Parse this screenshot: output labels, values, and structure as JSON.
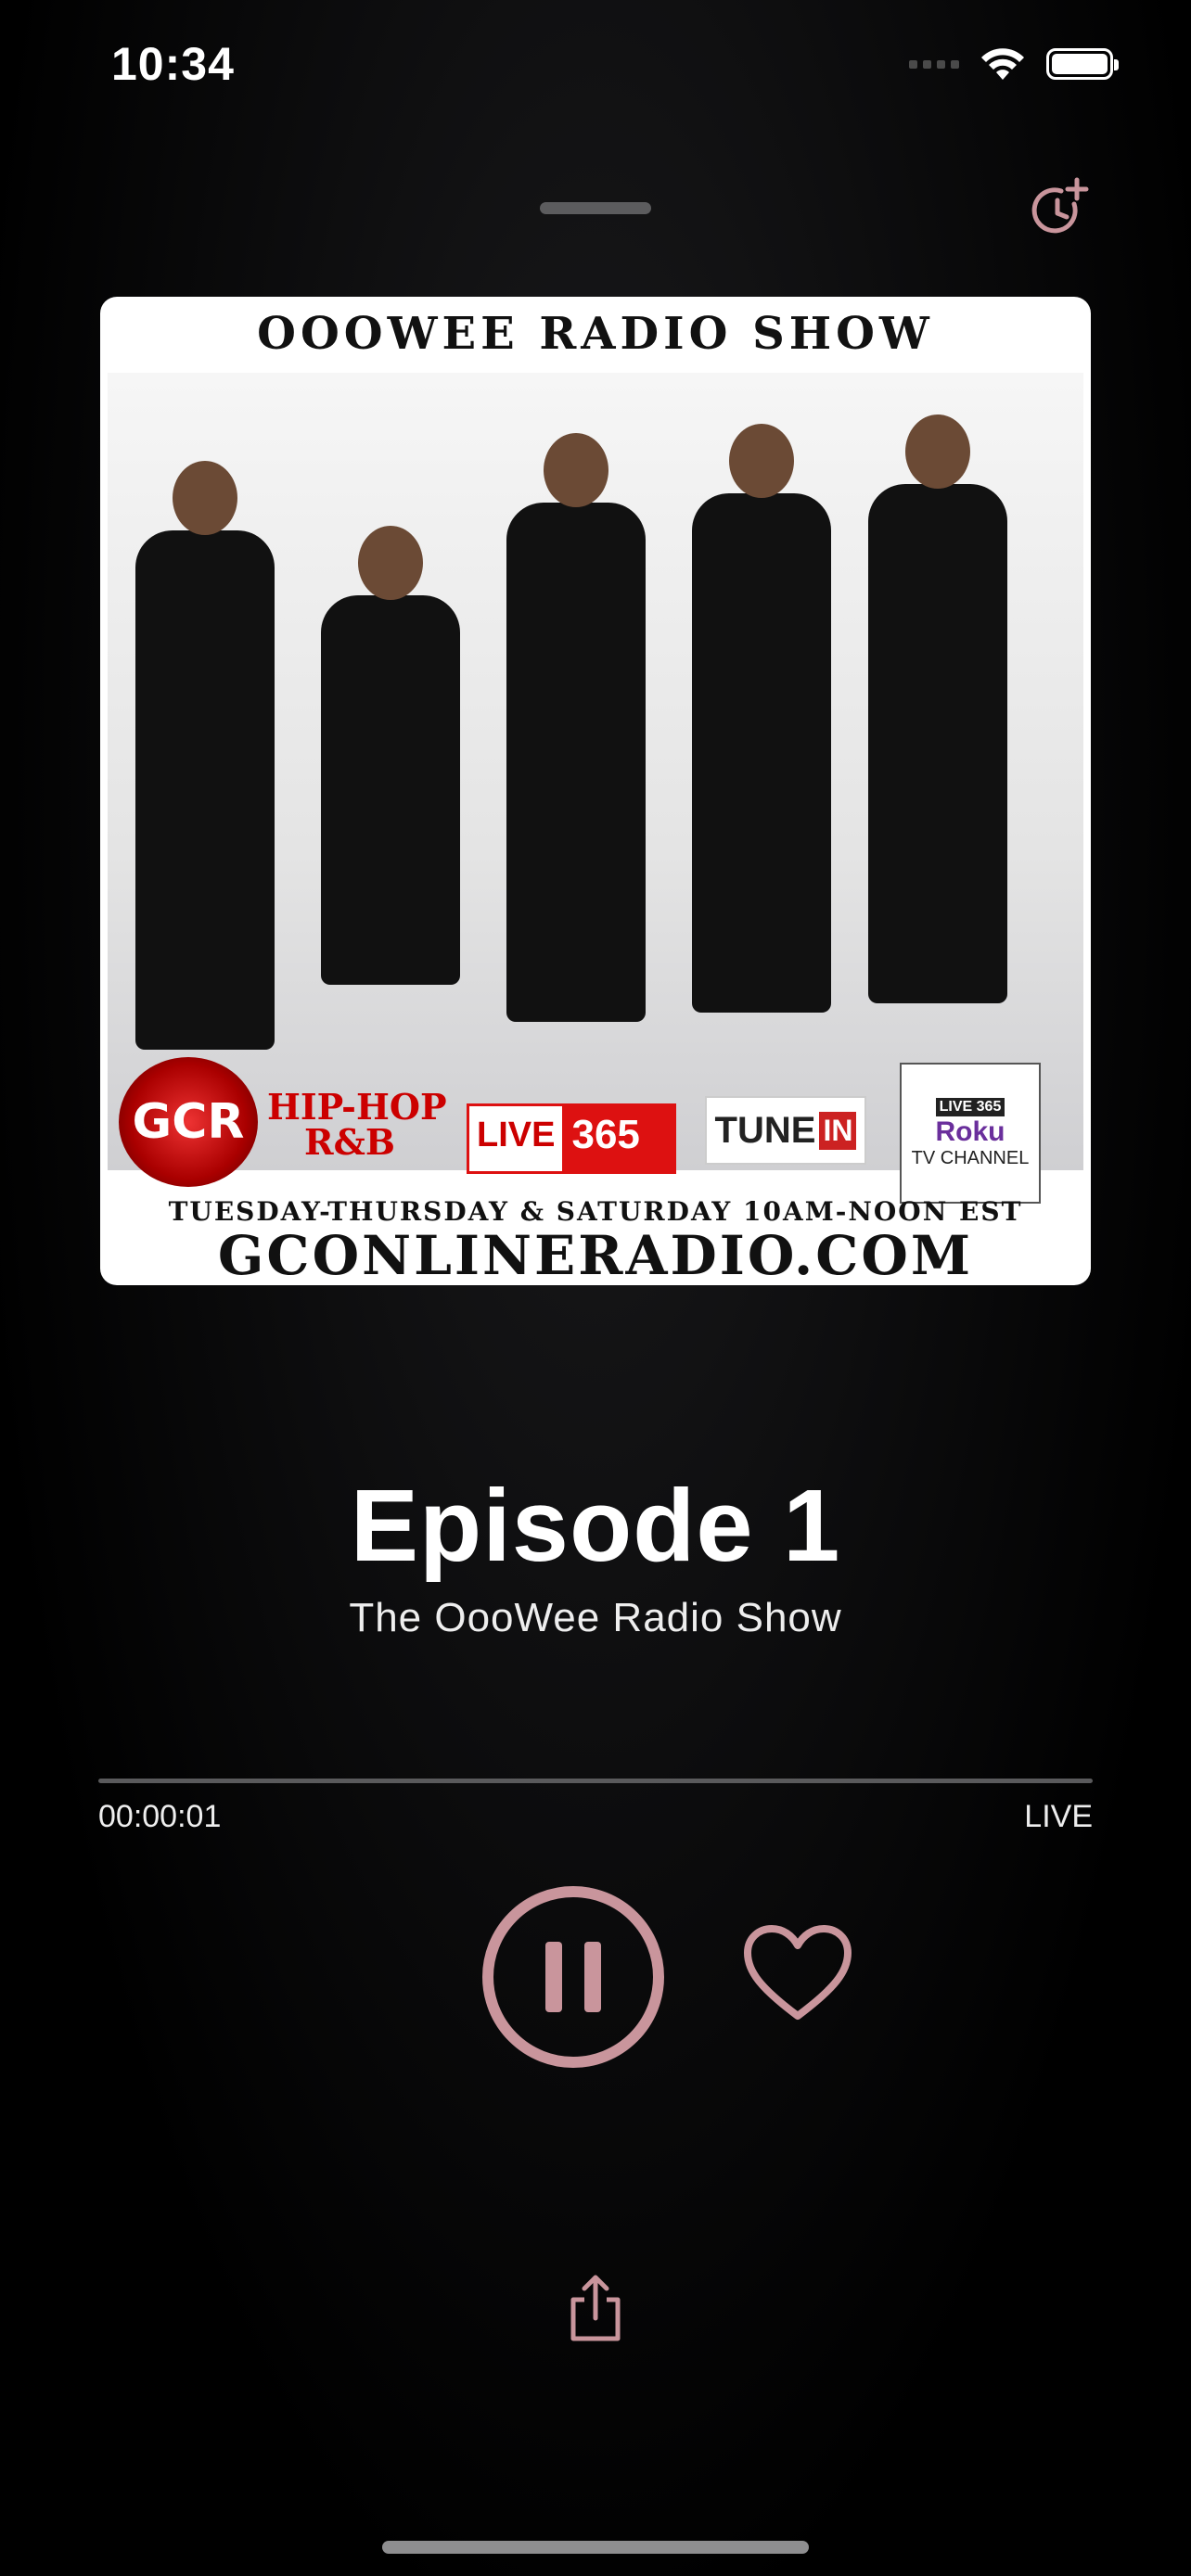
{
  "status_bar": {
    "time": "10:34"
  },
  "artwork": {
    "banner_top": "OOOWEE RADIO SHOW",
    "logos": {
      "gcr": "GCR",
      "hiphop_line1": "HIP-HOP",
      "hiphop_line2": "R&B",
      "live365_left": "LIVE",
      "live365_right": "365",
      "tunein_left": "TUNE",
      "tunein_right": "IN",
      "roku_top": "LIVE 365",
      "roku_mid": "Roku",
      "roku_bottom": "TV CHANNEL"
    },
    "schedule": "TUESDAY-THURSDAY & SATURDAY 10AM-NOON EST",
    "website": "GCONLINERADIO.COM"
  },
  "now_playing": {
    "title": "Episode 1",
    "show": "The OooWee Radio Show",
    "elapsed": "00:00:01",
    "duration_label": "LIVE",
    "progress": 0.0
  },
  "colors": {
    "accent": "#c9959c",
    "text": "#ffffff",
    "track": "#5a5a5c"
  },
  "icons": {
    "sleep_timer": "clock-plus-icon",
    "pause": "pause-circle-icon",
    "favorite": "heart-icon",
    "share": "share-icon"
  }
}
